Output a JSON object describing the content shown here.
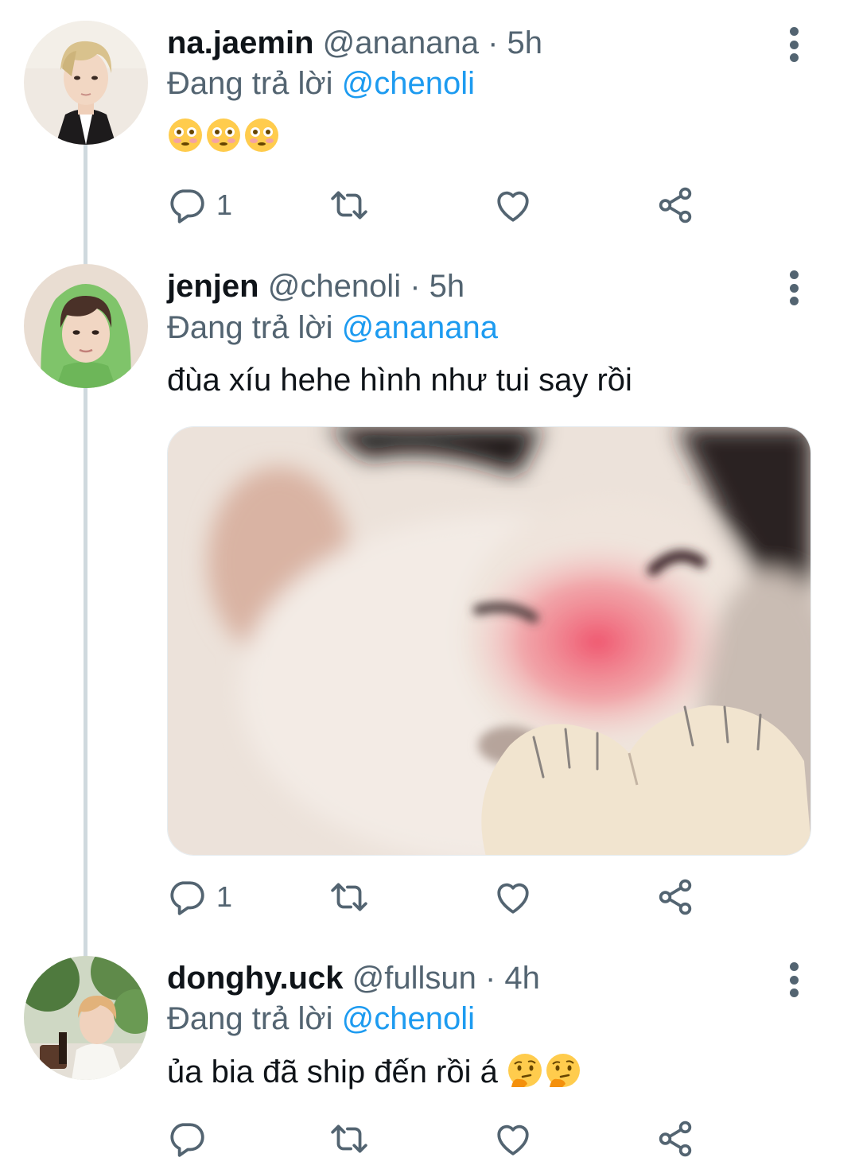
{
  "tweets": [
    {
      "name": "na.jaemin",
      "handle": "@ananana",
      "dot": "·",
      "time": "5h",
      "reply_prefix": "Đang trả lời",
      "reply_to": "@chenoli",
      "text": "",
      "emojis": [
        "flushed-face",
        "flushed-face",
        "flushed-face"
      ],
      "actions": {
        "reply_count": "1",
        "retweet_count": "",
        "like_count": ""
      }
    },
    {
      "name": "jenjen",
      "handle": "@chenoli",
      "dot": "·",
      "time": "5h",
      "reply_prefix": "Đang trả lời",
      "reply_to": "@ananana",
      "text": "đùa xíu hehe hình như tui say rồi",
      "has_image": true,
      "actions": {
        "reply_count": "1",
        "retweet_count": "",
        "like_count": ""
      }
    },
    {
      "name": "donghy.uck",
      "handle": "@fullsun",
      "dot": "·",
      "time": "4h",
      "reply_prefix": "Đang trả lời",
      "reply_to": "@chenoli",
      "text": "ủa bia đã ship đến rồi á",
      "emojis": [
        "thinking-face",
        "thinking-face"
      ],
      "actions": {
        "reply_count": "",
        "retweet_count": "",
        "like_count": ""
      }
    }
  ],
  "colors": {
    "text": "#0f1419",
    "secondary": "#536471",
    "mention": "#1d9bf0",
    "thread_line": "#cfd9de"
  }
}
